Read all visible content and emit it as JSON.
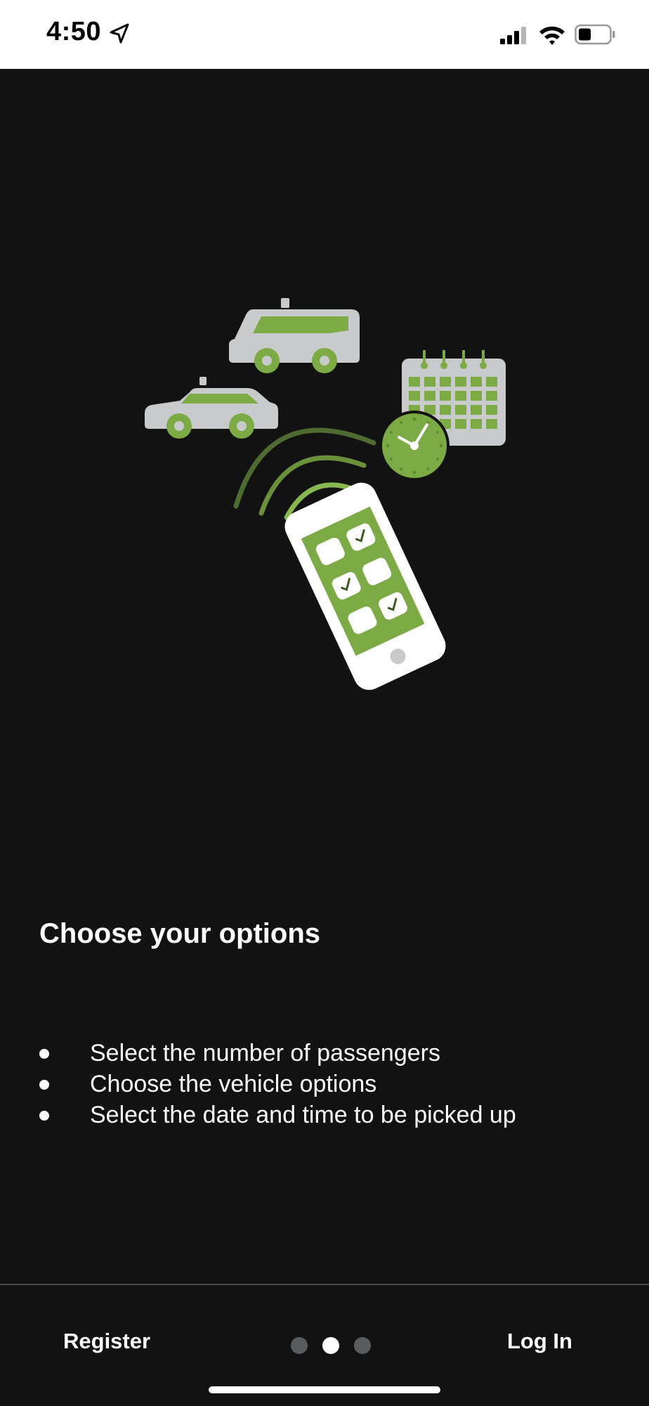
{
  "status_bar": {
    "time": "4:50",
    "icons": [
      "location-arrow-icon",
      "cellular-signal-icon",
      "wifi-icon",
      "battery-icon"
    ]
  },
  "illustration": {
    "icons": [
      "taxi-van-icon",
      "taxi-car-icon",
      "calendar-icon",
      "clock-icon",
      "signal-waves-icon",
      "smartphone-icon"
    ],
    "colors": {
      "accent": "#7CAA44",
      "vehicle": "#C9CACC",
      "background": "#121212"
    }
  },
  "content": {
    "title": "Choose your options",
    "bullets": [
      "Select the number of passengers",
      "Choose the vehicle options",
      "Select the date and time to be picked up"
    ]
  },
  "footer": {
    "register_label": "Register",
    "login_label": "Log In",
    "page_indicator": {
      "total": 3,
      "current": 2
    }
  }
}
